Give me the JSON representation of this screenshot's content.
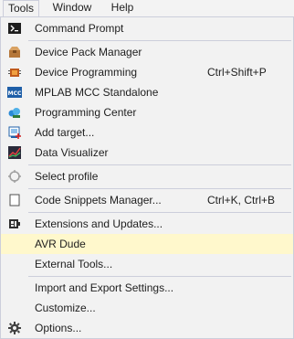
{
  "menubar": {
    "items": [
      {
        "label": "Tools"
      },
      {
        "label": "Window"
      },
      {
        "label": "Help"
      }
    ]
  },
  "menu": {
    "items": [
      {
        "label": "Command Prompt",
        "icon": "command-prompt-icon"
      },
      {
        "label": "Device Pack Manager",
        "icon": "device-pack-manager-icon"
      },
      {
        "label": "Device Programming",
        "shortcut": "Ctrl+Shift+P",
        "icon": "device-programming-icon"
      },
      {
        "label": "MPLAB MCC Standalone",
        "icon": "mcc-icon"
      },
      {
        "label": "Programming Center",
        "icon": "programming-center-icon"
      },
      {
        "label": "Add target...",
        "icon": "add-target-icon"
      },
      {
        "label": "Data Visualizer",
        "icon": "data-visualizer-icon"
      },
      {
        "label": "Select profile",
        "icon": "select-profile-icon"
      },
      {
        "label": "Code Snippets Manager...",
        "shortcut": "Ctrl+K, Ctrl+B",
        "icon": "code-snippets-icon"
      },
      {
        "label": "Extensions and Updates...",
        "icon": "extensions-icon"
      },
      {
        "label": "AVR Dude",
        "highlighted": true
      },
      {
        "label": "External Tools..."
      },
      {
        "label": "Import and Export Settings..."
      },
      {
        "label": "Customize..."
      },
      {
        "label": "Options...",
        "icon": "gear-icon"
      }
    ]
  },
  "colors": {
    "menu_background": "#f2f2f2",
    "highlight": "#fff8cc",
    "separator": "#cccedb",
    "text": "#1e1e1e"
  }
}
